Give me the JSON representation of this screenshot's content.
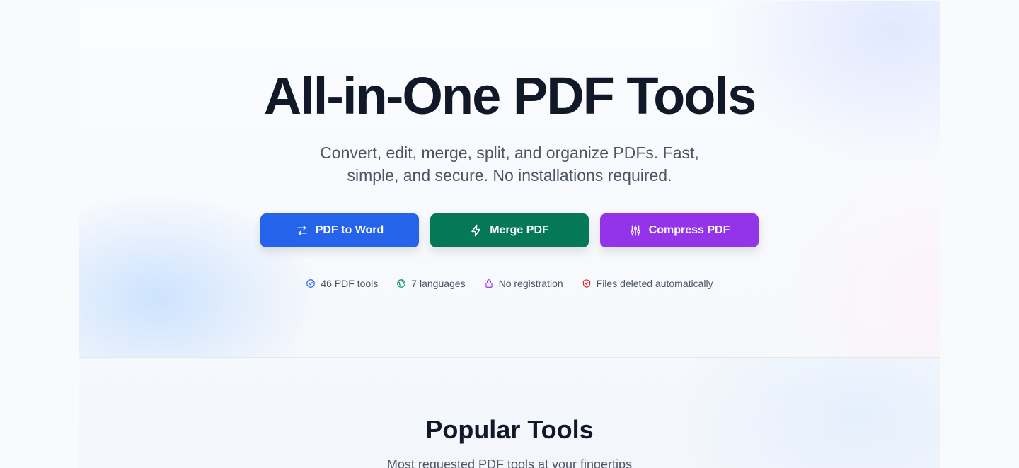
{
  "hero": {
    "title": "All-in-One PDF Tools",
    "subtitle": "Convert, edit, merge, split, and organize PDFs. Fast, simple, and secure. No installations required.",
    "buttons": [
      {
        "label": "PDF to Word",
        "icon": "arrows-exchange-icon",
        "color": "#2563eb"
      },
      {
        "label": "Merge PDF",
        "icon": "lightning-icon",
        "color": "#047857"
      },
      {
        "label": "Compress PDF",
        "icon": "sliders-icon",
        "color": "#9333ea"
      }
    ],
    "features": [
      {
        "label": "46 PDF tools",
        "icon": "check-circle-icon",
        "color": "#2563eb"
      },
      {
        "label": "7 languages",
        "icon": "globe-icon",
        "color": "#059669"
      },
      {
        "label": "No registration",
        "icon": "lock-icon",
        "color": "#9333ea"
      },
      {
        "label": "Files deleted automatically",
        "icon": "shield-check-icon",
        "color": "#dc2626"
      }
    ]
  },
  "popular": {
    "title": "Popular Tools",
    "subtitle": "Most requested PDF tools at your fingertips"
  }
}
